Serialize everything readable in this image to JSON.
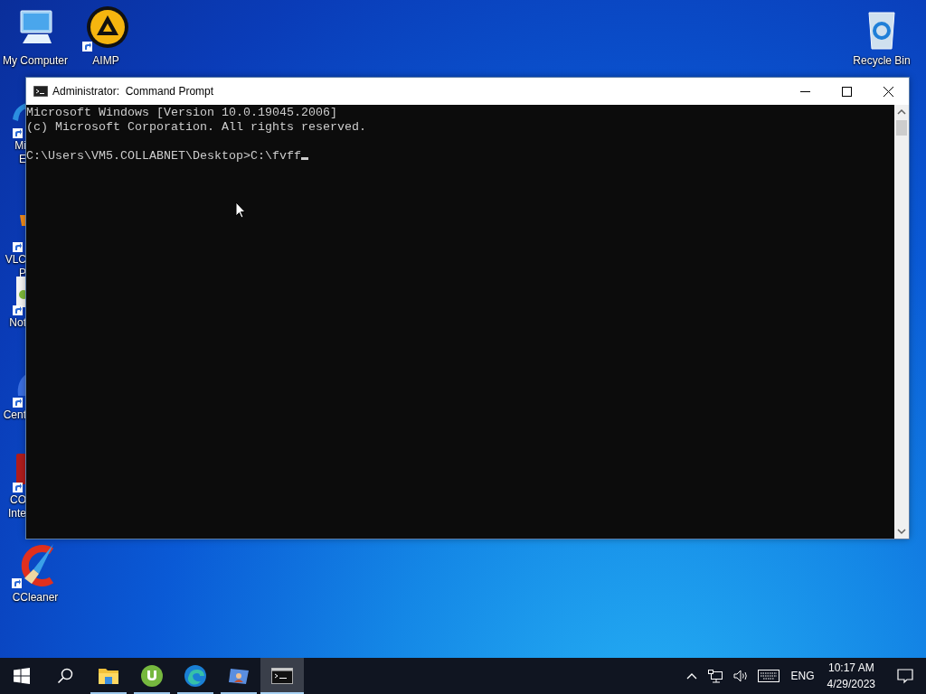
{
  "desktop_icons": [
    {
      "kind": "computer",
      "label": "My Computer",
      "shortcut": false
    },
    {
      "kind": "aimp",
      "label": "AIMP",
      "shortcut": true
    },
    {
      "kind": "recycle",
      "label": "Recycle Bin",
      "shortcut": false
    },
    {
      "kind": "ccleaner",
      "label": "CCleaner",
      "shortcut": true
    }
  ],
  "covered_icons": [
    {
      "kind": "edge",
      "lines": [
        "Mi",
        "E"
      ],
      "shortcut": true
    },
    {
      "kind": "vlc",
      "lines": [
        "VLC",
        "P"
      ],
      "shortcut": true
    },
    {
      "kind": "notepad",
      "lines": [
        "Not"
      ],
      "shortcut": true
    },
    {
      "kind": "app",
      "lines": [
        "Cent"
      ],
      "shortcut": true
    },
    {
      "kind": "redapp",
      "lines": [
        "CO",
        "Inte"
      ],
      "shortcut": true
    }
  ],
  "window": {
    "title": "Administrator:  Command Prompt",
    "console_blocks": [
      [
        "Microsoft Windows [Version 10.0.19045.2006]",
        "(c) Microsoft Corporation. All rights reserved."
      ],
      [
        "C:\\Users\\VM5.COLLABNET\\Desktop>C:\\fvff"
      ]
    ],
    "cursor": true
  },
  "taskbar": {
    "items": [
      {
        "kind": "start",
        "running": false,
        "selected": false
      },
      {
        "kind": "search",
        "running": false,
        "selected": false
      },
      {
        "kind": "explorer",
        "running": true,
        "selected": false
      },
      {
        "kind": "utorrent",
        "running": true,
        "selected": false
      },
      {
        "kind": "edge",
        "running": true,
        "selected": false
      },
      {
        "kind": "photo",
        "running": true,
        "selected": false
      },
      {
        "kind": "cmd",
        "running": true,
        "selected": true
      }
    ],
    "language": "ENG",
    "time": "10:17 AM",
    "date": "4/29/2023"
  }
}
